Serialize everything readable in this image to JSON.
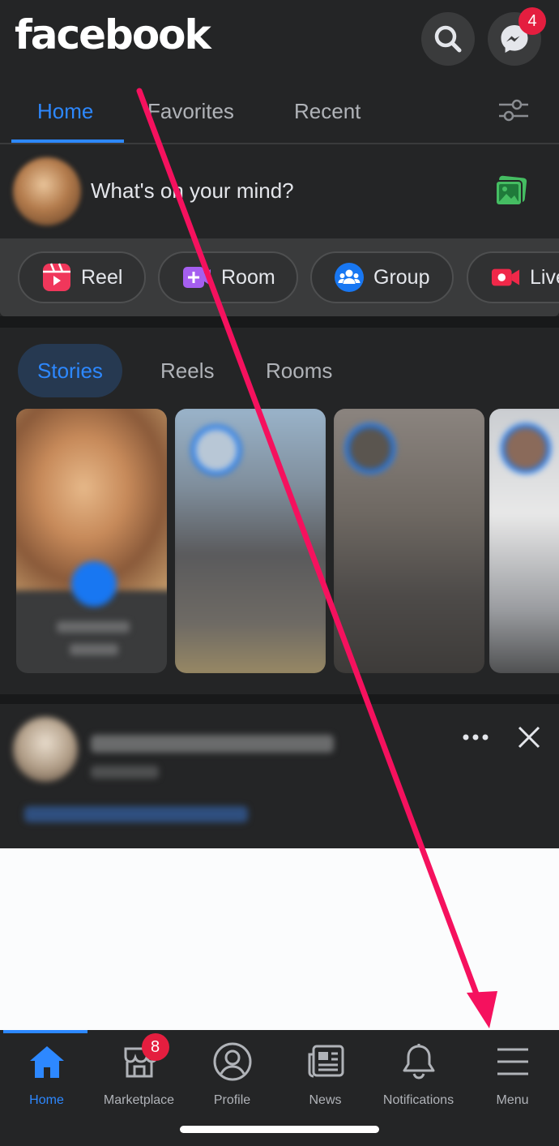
{
  "app": {
    "brand": "facebook",
    "accent": "#2d88ff",
    "badge_color": "#e41e3f"
  },
  "header": {
    "search_icon": "search-icon",
    "messenger_icon": "messenger-icon",
    "messenger_badge": "4"
  },
  "tabs": [
    {
      "label": "Home",
      "active": true
    },
    {
      "label": "Favorites",
      "active": false
    },
    {
      "label": "Recent",
      "active": false
    }
  ],
  "filter_icon": "sliders-icon",
  "composer": {
    "placeholder": "What's on your mind?",
    "photo_icon": "photo-icon"
  },
  "actions": [
    {
      "label": "Reel",
      "icon": "reel-icon"
    },
    {
      "label": "Room",
      "icon": "room-icon"
    },
    {
      "label": "Group",
      "icon": "group-icon"
    },
    {
      "label": "Live",
      "icon": "live-icon"
    }
  ],
  "story_tabs": [
    {
      "label": "Stories",
      "active": true
    },
    {
      "label": "Reels",
      "active": false
    },
    {
      "label": "Rooms",
      "active": false
    }
  ],
  "post": {
    "more_icon": "more-icon",
    "close_icon": "close-icon"
  },
  "bottom_nav": [
    {
      "label": "Home",
      "icon": "home-icon",
      "active": true
    },
    {
      "label": "Marketplace",
      "icon": "marketplace-icon",
      "badge": "8"
    },
    {
      "label": "Profile",
      "icon": "profile-icon"
    },
    {
      "label": "News",
      "icon": "news-icon"
    },
    {
      "label": "Notifications",
      "icon": "bell-icon"
    },
    {
      "label": "Menu",
      "icon": "menu-icon"
    }
  ],
  "annotation": {
    "arrow_color": "#f5115e"
  }
}
